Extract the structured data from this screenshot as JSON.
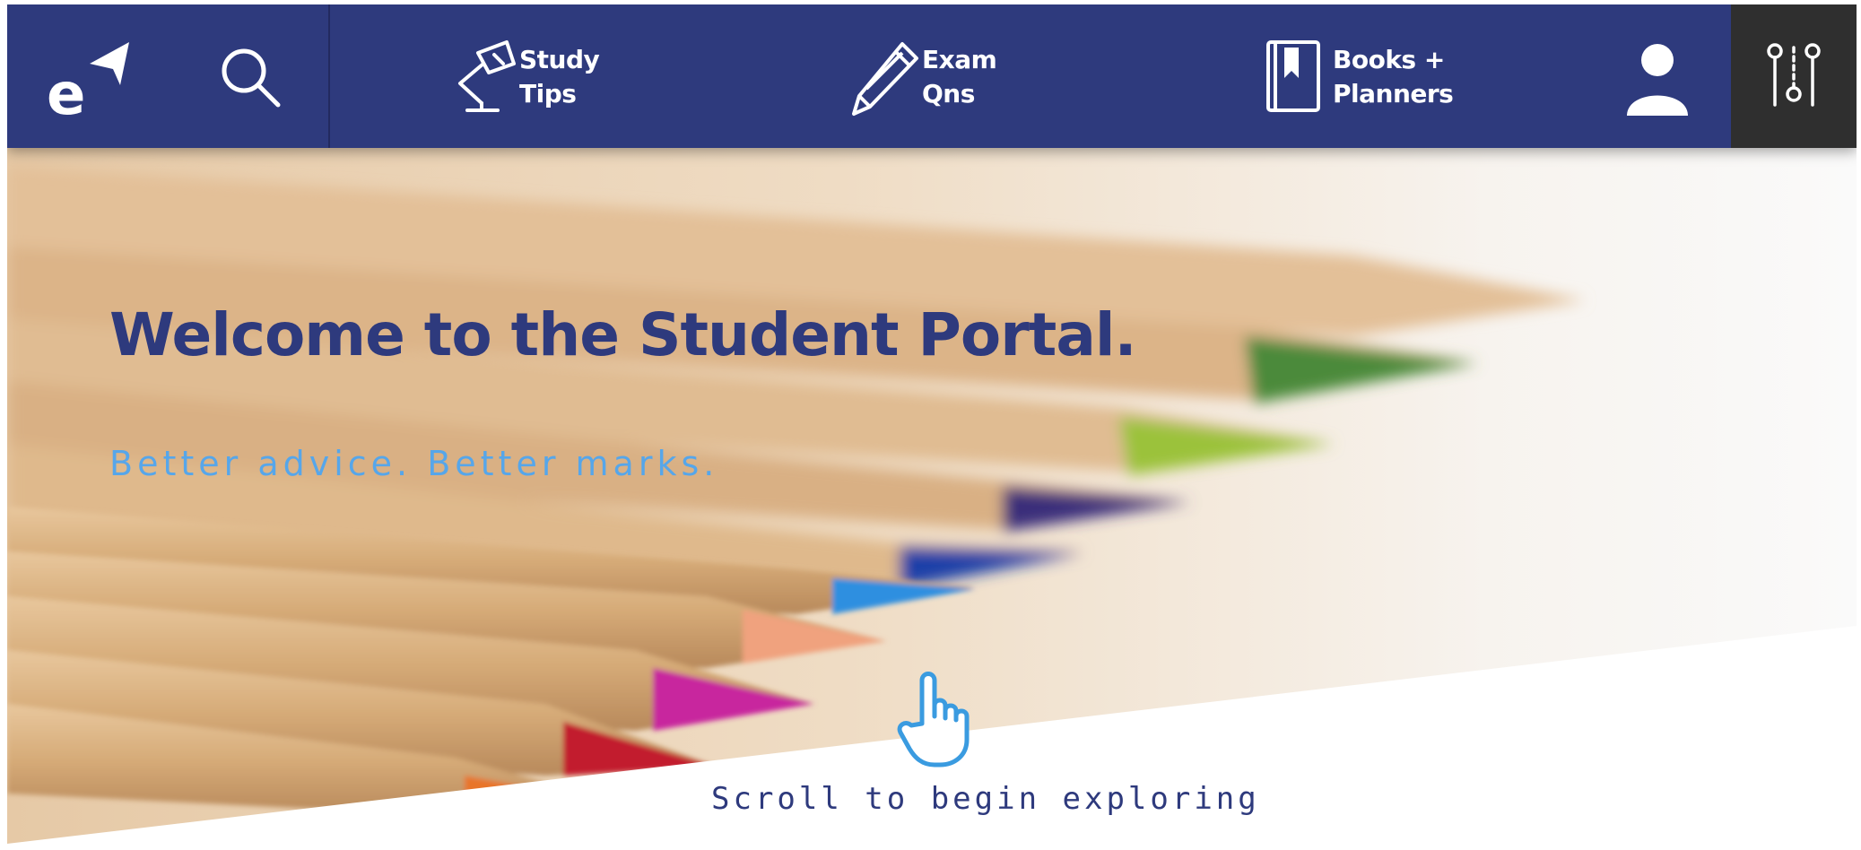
{
  "nav": {
    "logo_icon": "e-arrow-logo-icon",
    "search_icon": "search-icon",
    "items": [
      {
        "label": "Study\nTips",
        "icon": "desk-lamp-icon"
      },
      {
        "label": "Exam\nQns",
        "icon": "pencil-icon"
      },
      {
        "label": "Books +\nPlanners",
        "icon": "book-bookmark-icon"
      }
    ],
    "profile_icon": "user-icon",
    "settings_icon": "sliders-icon",
    "colors": {
      "bar": "#2e3a7d",
      "settings_bg": "#2f2f2f",
      "text": "#ffffff"
    }
  },
  "hero": {
    "title": "Welcome to the Student Portal.",
    "subtitle": "Better advice. Better marks.",
    "scroll_icon": "pointing-hand-icon",
    "scroll_text": "Scroll to begin exploring",
    "colors": {
      "title": "#2e3a7d",
      "subtitle": "#56a6ea",
      "scroll_icon": "#3a9be0"
    }
  }
}
